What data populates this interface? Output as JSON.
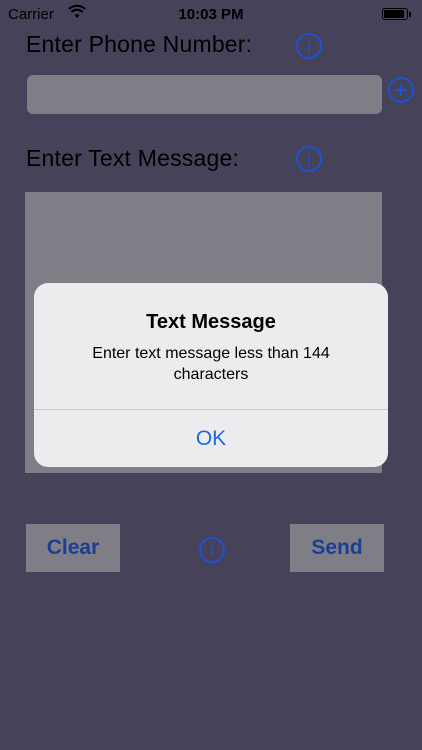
{
  "status_bar": {
    "carrier": "Carrier",
    "time": "10:03 PM",
    "wifi_icon": "wifi-icon",
    "battery_icon": "battery-icon"
  },
  "form": {
    "phone_label": "Enter Phone Number:",
    "message_label": "Enter Text Message:",
    "phone_value": "",
    "message_value": ""
  },
  "buttons": {
    "clear": "Clear",
    "send": "Send"
  },
  "icons": {
    "info": "i",
    "add_contact": "plus-circle-icon"
  },
  "alert": {
    "title": "Text Message",
    "message": "Enter text message less than 144 characters",
    "ok_label": "OK"
  },
  "colors": {
    "background": "#45425a",
    "field": "#7f7e86",
    "accent_blue": "#1d52d1",
    "button_text": "#1b3f95",
    "alert_bg": "#ececee",
    "alert_action": "#1a6de0"
  }
}
